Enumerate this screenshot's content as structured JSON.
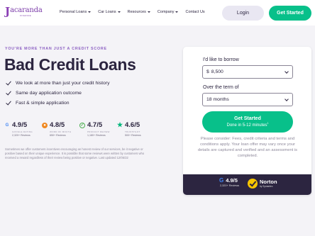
{
  "brand": {
    "logo_mark": "J",
    "name": "acaranda",
    "sub": "FINANCE"
  },
  "nav": {
    "links": [
      "Personal Loans",
      "Car Loans",
      "Resources",
      "Company",
      "Contact Us"
    ],
    "login_label": "Login",
    "get_started_label": "Get Started"
  },
  "hero": {
    "eyebrow": "YOU'RE MORE THAN JUST A CREDIT SCORE",
    "title": "Bad Credit Loans",
    "bullets": [
      "We look at more than just your credit history",
      "Same day application outcome",
      "Fast & simple application"
    ]
  },
  "ratings": [
    {
      "score": "4.9/5",
      "source": "GOOGLE RATING",
      "reviews": "2,320+ Reviews",
      "icon": "google-icon",
      "color": "#4285f4"
    },
    {
      "score": "4.8/5",
      "source": "WORD OF MOUTH",
      "reviews": "650+ Reviews",
      "icon": "word-of-mouth-icon",
      "color": "#f08a24"
    },
    {
      "score": "4.7/5",
      "source": "PRODUCT REVIEW",
      "reviews": "1,180+ Reviews",
      "icon": "product-review-icon",
      "color": "#4caf50"
    },
    {
      "score": "4.6/5",
      "source": "TRUSTPILOT",
      "reviews": "500+ Reviews",
      "icon": "trustpilot-star-icon",
      "color": "#00b67a"
    }
  ],
  "disclaimer": "Sometimes we offer customers incentives encouraging an honest review of our services, be it negative or positive based on their unique experience. It is possible that some reviews were written by customers who received a reward regardless of their review being positive or negative. Last updated 12/05/22",
  "form": {
    "borrow_label": "I'd like to borrow",
    "borrow_currency": "$",
    "borrow_value": "8,500",
    "term_label": "Over the term of",
    "term_value": "18 months",
    "cta_line1": "Get Started",
    "cta_line2": "Done in 5-12 minutes",
    "cta_sup": "1",
    "note": "Please consider: Fees, credit criteria and terms and conditions apply. Your loan offer may vary once your details are captured and verified and an assessment is completed."
  },
  "card_footer": {
    "google_score": "4.9/5",
    "google_reviews": "2,320+ Reviews",
    "norton_name": "Norton",
    "norton_sub": "by Symantec"
  },
  "colors": {
    "accent": "#08c08a",
    "brand": "#8b3fb5",
    "dark": "#2c2540"
  }
}
